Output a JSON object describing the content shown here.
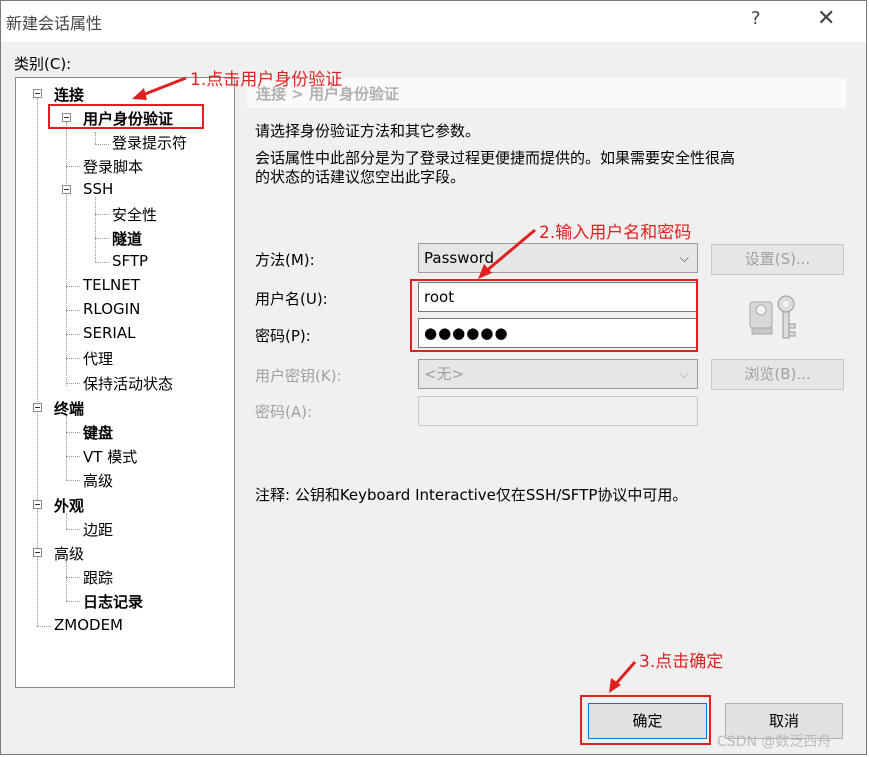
{
  "window": {
    "title": "新建会话属性",
    "help_glyph": "?",
    "close_glyph": "✕"
  },
  "category": {
    "label": "类别(C):",
    "tree": [
      {
        "label": "连接"
      },
      {
        "label": "用户身份验证"
      },
      {
        "label": "登录提示符"
      },
      {
        "label": "登录脚本"
      },
      {
        "label": "SSH"
      },
      {
        "label": "安全性"
      },
      {
        "label": "隧道"
      },
      {
        "label": "SFTP"
      },
      {
        "label": "TELNET"
      },
      {
        "label": "RLOGIN"
      },
      {
        "label": "SERIAL"
      },
      {
        "label": "代理"
      },
      {
        "label": "保持活动状态"
      },
      {
        "label": "终端"
      },
      {
        "label": "键盘"
      },
      {
        "label": "VT 模式"
      },
      {
        "label": "高级"
      },
      {
        "label": "外观"
      },
      {
        "label": "边距"
      },
      {
        "label": "高级"
      },
      {
        "label": "跟踪"
      },
      {
        "label": "日志记录"
      },
      {
        "label": "ZMODEM"
      }
    ]
  },
  "panel": {
    "breadcrumb": "连接 > 用户身份验证",
    "desc1": "请选择身份验证方法和其它参数。",
    "desc2": "会话属性中此部分是为了登录过程更便捷而提供的。如果需要安全性很高",
    "desc3": "的状态的话建议您空出此字段。",
    "method_label": "方法(M):",
    "method_value": "Password",
    "settings_button": "设置(S)...",
    "username_label": "用户名(U):",
    "username_value": "root",
    "password_label": "密码(P):",
    "password_value": "●●●●●●",
    "userkey_label": "用户密钥(K):",
    "userkey_value": "<无>",
    "browse_button": "浏览(B)...",
    "passphrase_label": "密码(A):",
    "note": "注释: 公钥和Keyboard Interactive仅在SSH/SFTP协议中可用。"
  },
  "buttons": {
    "ok": "确定",
    "cancel": "取消"
  },
  "annotations": {
    "step1": "1.点击用户身份验证",
    "step2": "2.输入用户名和密码",
    "step3": "3.点击确定"
  },
  "watermark": "CSDN @数泛西舟",
  "colors": {
    "annotation": "#e02020"
  }
}
